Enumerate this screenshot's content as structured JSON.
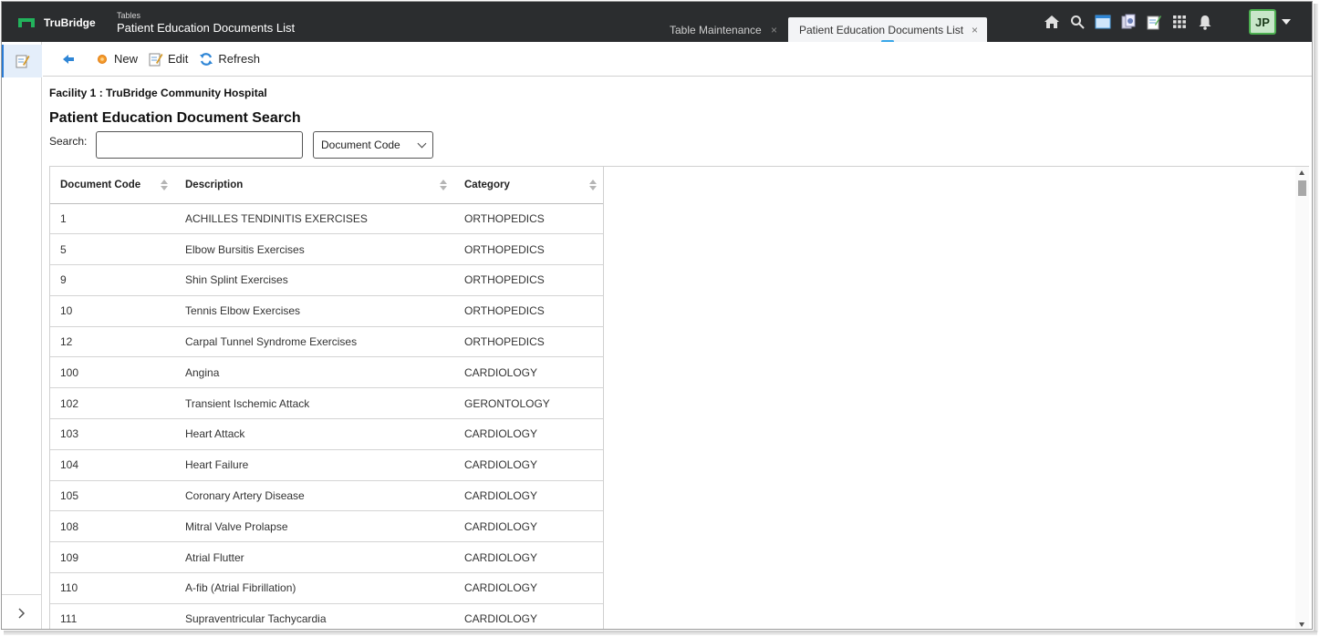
{
  "app": {
    "brand": "TruBridge",
    "section": "Tables",
    "page_title": "Patient Education Documents List"
  },
  "tabs": [
    {
      "label": "Table Maintenance",
      "close": "×"
    },
    {
      "label": "Patient Education Documents List",
      "close": "×"
    }
  ],
  "top_icons": [
    "home-icon",
    "search-icon",
    "window-icon",
    "documents-icon",
    "notes-icon",
    "apps-grid-icon",
    "bell-icon"
  ],
  "user": {
    "initials": "JP"
  },
  "toolbar": {
    "back_icon": "back-arrow-icon",
    "new_label": "New",
    "edit_label": "Edit",
    "refresh_label": "Refresh"
  },
  "facility": "Facility 1 : TruBridge Community Hospital",
  "search": {
    "title": "Patient Education Document Search",
    "label": "Search:",
    "value": "",
    "filter_selected": "Document Code"
  },
  "table": {
    "columns": [
      "Document Code",
      "Description",
      "Category"
    ],
    "rows": [
      [
        "1",
        "ACHILLES TENDINITIS EXERCISES",
        "ORTHOPEDICS"
      ],
      [
        "5",
        "Elbow Bursitis Exercises",
        "ORTHOPEDICS"
      ],
      [
        "9",
        "Shin Splint Exercises",
        "ORTHOPEDICS"
      ],
      [
        "10",
        "Tennis Elbow Exercises",
        "ORTHOPEDICS"
      ],
      [
        "12",
        "Carpal Tunnel Syndrome Exercises",
        "ORTHOPEDICS"
      ],
      [
        "100",
        "Angina",
        "CARDIOLOGY"
      ],
      [
        "102",
        "Transient Ischemic Attack",
        "GERONTOLOGY"
      ],
      [
        "103",
        "Heart Attack",
        "CARDIOLOGY"
      ],
      [
        "104",
        "Heart Failure",
        "CARDIOLOGY"
      ],
      [
        "105",
        "Coronary Artery Disease",
        "CARDIOLOGY"
      ],
      [
        "108",
        "Mitral Valve Prolapse",
        "CARDIOLOGY"
      ],
      [
        "109",
        "Atrial Flutter",
        "CARDIOLOGY"
      ],
      [
        "110",
        "A-fib (Atrial Fibrillation)",
        "CARDIOLOGY"
      ],
      [
        "111",
        "Supraventricular Tachycardia",
        "CARDIOLOGY"
      ]
    ]
  },
  "colors": {
    "topbar": "#2b2d2f",
    "brand_green": "#22b35c",
    "active_rail": "#2a7bd5",
    "avatar_bg": "#c8e6c9"
  }
}
